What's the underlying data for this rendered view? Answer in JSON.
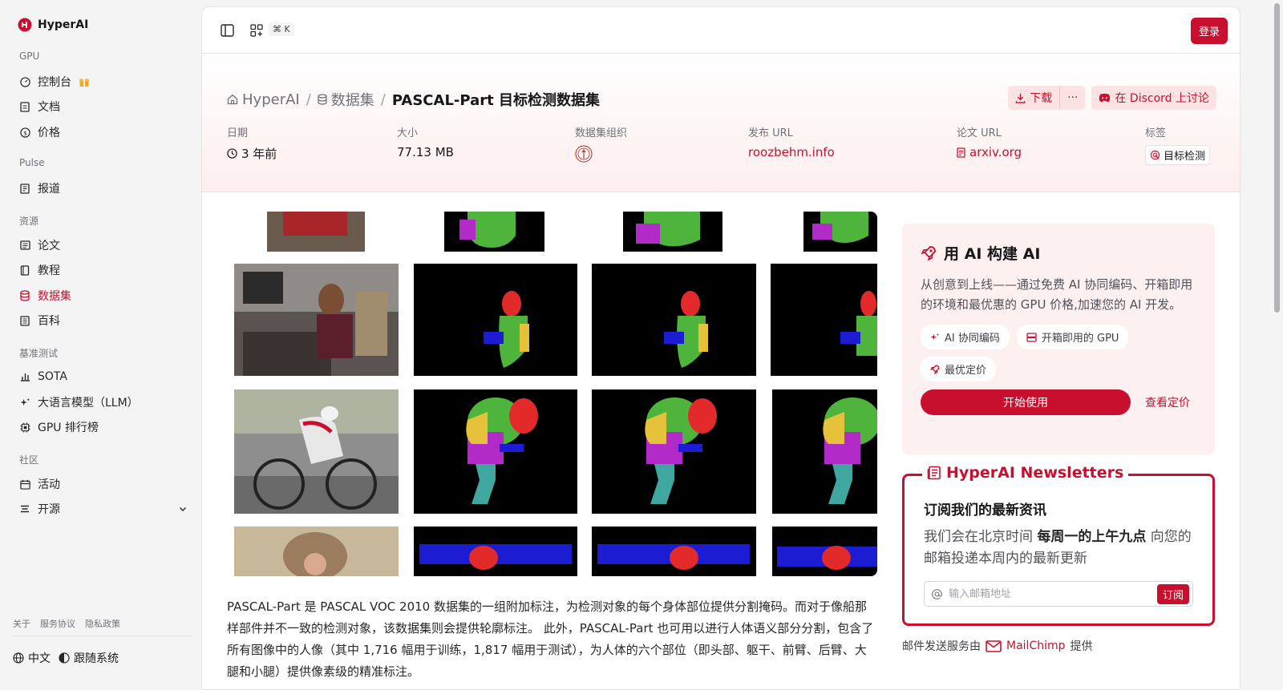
{
  "brand": {
    "name": "HyperAI"
  },
  "sidebar": {
    "groups": [
      "GPU",
      "Pulse",
      "资源",
      "基准测试",
      "社区"
    ],
    "items": [
      {
        "label": "控制台",
        "icon": "gauge-icon"
      },
      {
        "label": "文档",
        "icon": "doc-icon"
      },
      {
        "label": "价格",
        "icon": "dollar-icon"
      },
      {
        "label": "报道",
        "icon": "news-icon"
      },
      {
        "label": "论文",
        "icon": "paper-icon"
      },
      {
        "label": "教程",
        "icon": "book-icon"
      },
      {
        "label": "数据集",
        "icon": "database-icon"
      },
      {
        "label": "百科",
        "icon": "wiki-icon"
      },
      {
        "label": "SOTA",
        "icon": "bar-chart-icon"
      },
      {
        "label": "大语言模型（LLM）",
        "icon": "sparkles-icon"
      },
      {
        "label": "GPU 排行榜",
        "icon": "cpu-icon"
      },
      {
        "label": "活动",
        "icon": "calendar-icon"
      },
      {
        "label": "开源",
        "icon": "menu-icon"
      }
    ],
    "footer_links": [
      "关于",
      "服务协议",
      "隐私政策"
    ],
    "language": "中文",
    "theme": "跟随系统"
  },
  "topbar": {
    "shortcut": "⌘ K",
    "login": "登录"
  },
  "breadcrumb": {
    "home": "HyperAI",
    "section": "数据集",
    "current": "PASCAL-Part 目标检测数据集"
  },
  "actions": {
    "download": "下载",
    "more": "···",
    "discord": "在 Discord 上讨论"
  },
  "meta": {
    "date_label": "日期",
    "date_value": "3 年前",
    "size_label": "大小",
    "size_value": "77.13 MB",
    "org_label": "数据集组织",
    "url_label": "发布 URL",
    "url_value": "roozbehm.info",
    "paper_label": "论文 URL",
    "paper_value": "arxiv.org",
    "tags_label": "标签",
    "tag_value": "目标检测"
  },
  "description": "PASCAL-Part 是 PASCAL VOC 2010 数据集的一组附加标注，为检测对象的每个身体部位提供分割掩码。而对于像船那样部件并不一致的检测对象，该数据集则会提供轮廓标注。 此外，PASCAL-Part 也可用以进行人体语义部分分割，包含了所有图像中的人像（其中 1,716 幅用于训练，1,817 幅用于测试），为人体的六个部位（即头部、躯干、前臂、后臂、大腿和小腿）提供像素级的精准标注。",
  "promo": {
    "title": "用 AI 构建 AI",
    "desc": "从创意到上线——通过免费 AI 协同编码、开箱即用的环境和最优惠的 GPU 价格,加速您的 AI 开发。",
    "chips": [
      "AI 协同编码",
      "开箱即用的 GPU",
      "最优定价"
    ],
    "start": "开始使用",
    "pricing": "查看定价"
  },
  "newsletter": {
    "title": "HyperAI Newsletters",
    "subtitle": "订阅我们的最新资讯",
    "desc_pre": "我们会在北京时间 ",
    "desc_bold": "每周一的上午九点",
    "desc_post": " 向您的邮箱投递本周内的最新更新",
    "placeholder": "输入邮箱地址",
    "subscribe": "订阅",
    "credit_pre": "邮件发送服务由",
    "credit_brand": "MailChimp",
    "credit_post": "提供"
  },
  "colors": {
    "accent": "#c8102e",
    "head": "#e32a2a",
    "torso": "#4fb43c",
    "arm": "#1c1cd2",
    "arm2": "#b22ac8",
    "leg": "#3fa6a0",
    "upper": "#e6c23a"
  }
}
